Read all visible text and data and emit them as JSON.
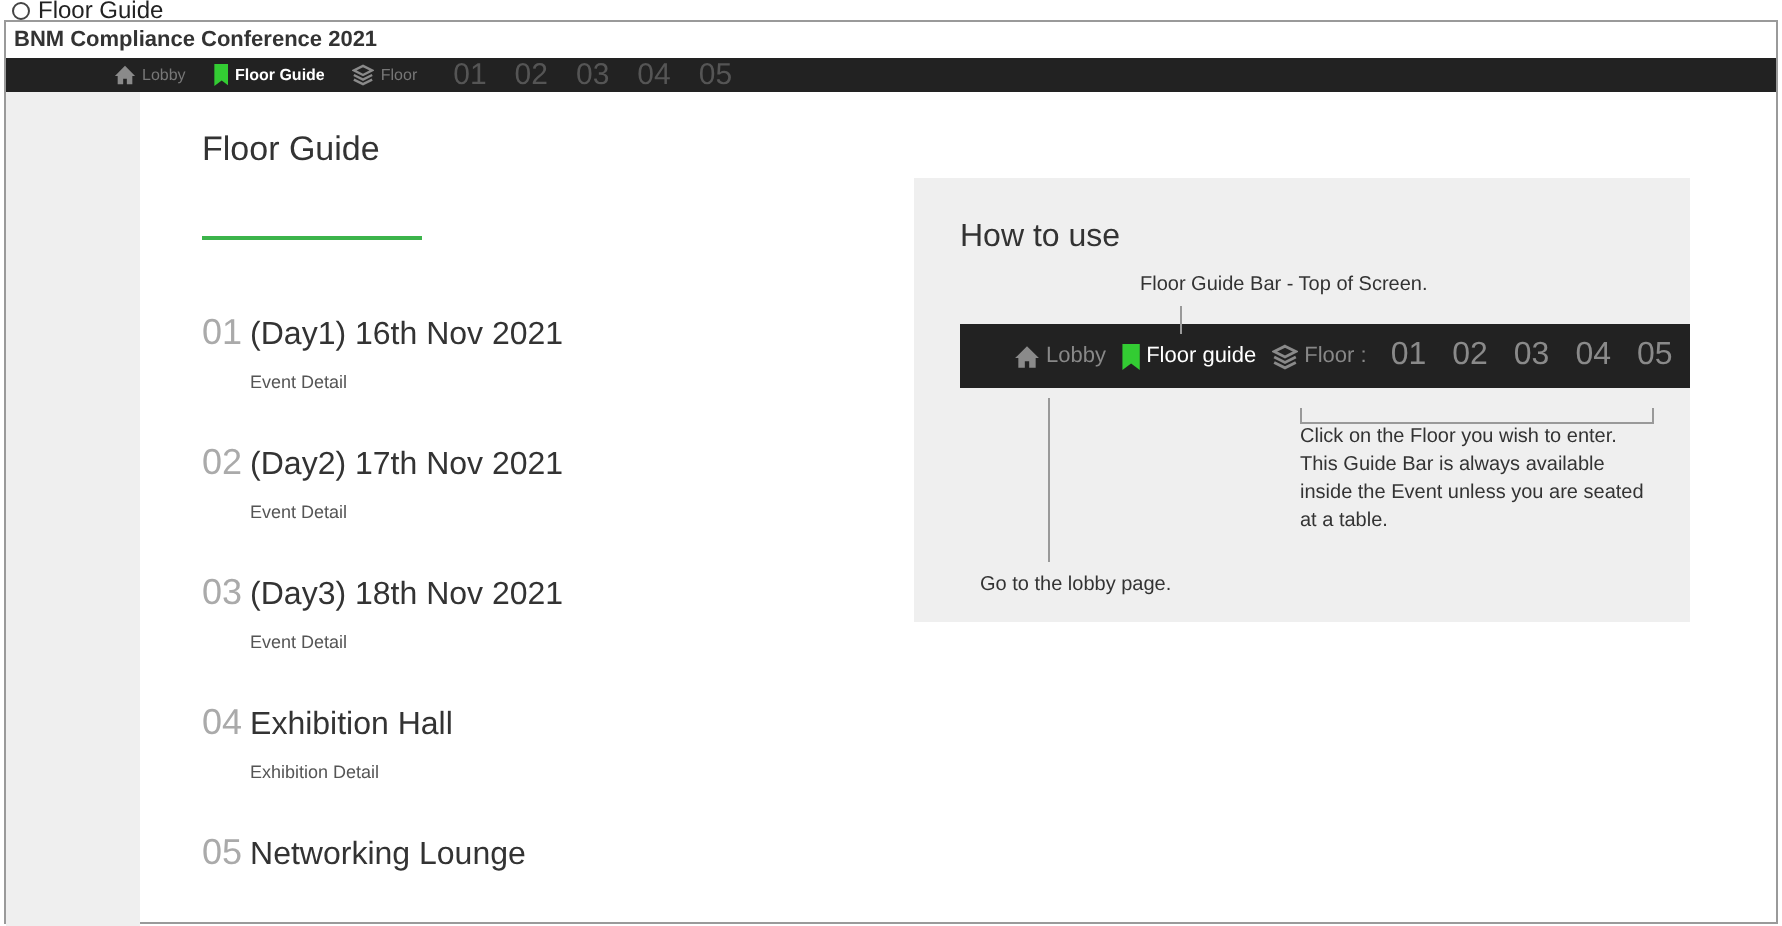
{
  "caption": {
    "title": "Floor Guide"
  },
  "window": {
    "title": "BNM Compliance Conference 2021"
  },
  "nav": {
    "items": [
      {
        "kind": "lobby",
        "label": "Lobby",
        "selected": false
      },
      {
        "kind": "guide",
        "label": "Floor Guide",
        "selected": true
      },
      {
        "kind": "floor",
        "label": "Floor",
        "selected": false
      }
    ],
    "floors": [
      "01",
      "02",
      "03",
      "04",
      "05"
    ]
  },
  "guide": {
    "heading": "Floor Guide",
    "entries": [
      {
        "number": "01",
        "title": "(Day1) 16th Nov 2021",
        "detail": "Event Detail"
      },
      {
        "number": "02",
        "title": "(Day2) 17th Nov 2021",
        "detail": "Event Detail"
      },
      {
        "number": "03",
        "title": "(Day3) 18th Nov 2021",
        "detail": "Event Detail"
      },
      {
        "number": "04",
        "title": "Exhibition Hall",
        "detail": "Exhibition Detail"
      },
      {
        "number": "05",
        "title": "Networking Lounge"
      }
    ]
  },
  "help": {
    "heading": "How to use",
    "top_note": "Floor Guide Bar - Top of Screen.",
    "bar": {
      "items": [
        {
          "kind": "lobby",
          "label": "Lobby",
          "selected": false
        },
        {
          "kind": "guide",
          "label": "Floor guide",
          "selected": true
        },
        {
          "kind": "floor",
          "label": "Floor :",
          "selected": false
        }
      ],
      "floors": [
        "01",
        "02",
        "03",
        "04",
        "05"
      ]
    },
    "floor_note": "Click on the Floor you wish to enter. This Guide Bar is always available inside the Event unless you are seated at a table.",
    "lobby_note": "Go to the lobby page."
  }
}
